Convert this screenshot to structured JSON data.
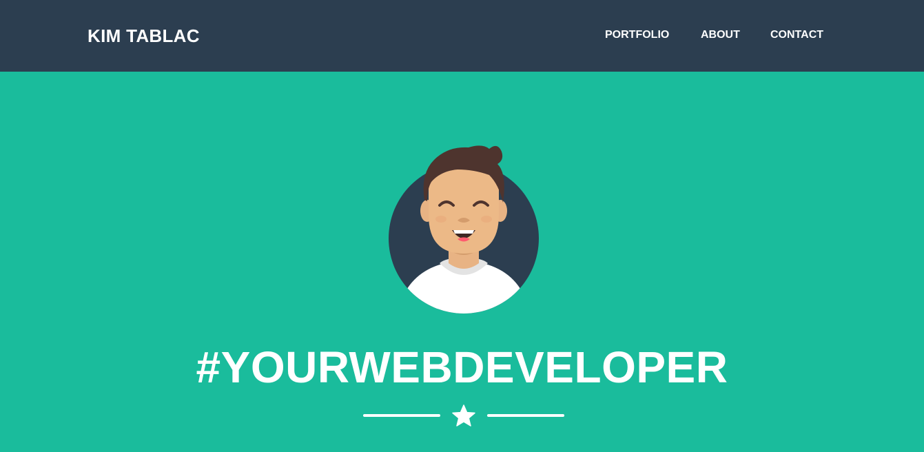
{
  "navbar": {
    "brand": "KIM TABLAC",
    "links": [
      {
        "label": "PORTFOLIO"
      },
      {
        "label": "ABOUT"
      },
      {
        "label": "CONTACT"
      }
    ]
  },
  "masthead": {
    "headline": "#YOURWEBDEVELOPER",
    "avatar_icon": "avatar-icon",
    "divider_icon": "star-icon"
  },
  "colors": {
    "navbar_bg": "#2c3e50",
    "masthead_bg": "#1abc9c",
    "text": "#ffffff"
  }
}
